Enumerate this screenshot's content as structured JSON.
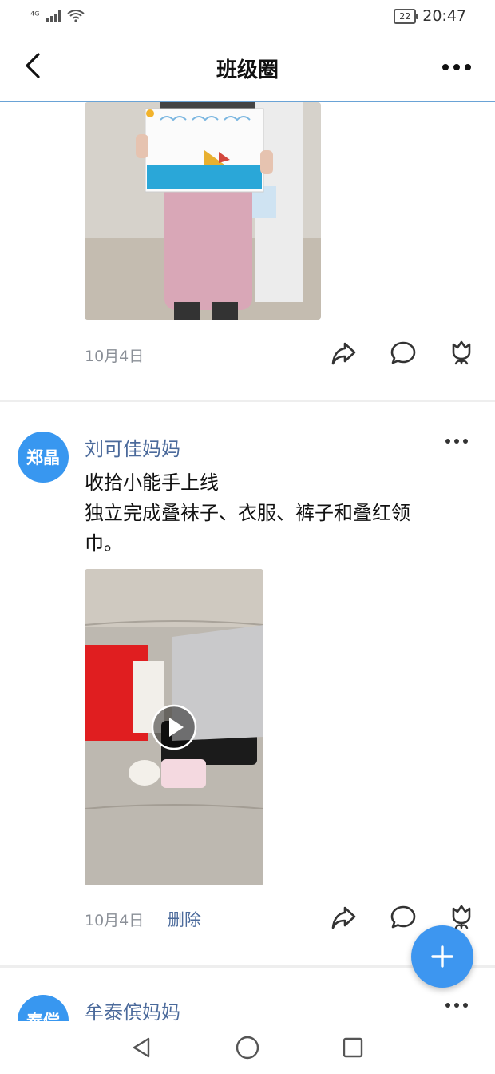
{
  "status": {
    "signal": "⁴ᴳ",
    "battery": "22",
    "time": "20:47"
  },
  "header": {
    "title": "班级圈"
  },
  "post1": {
    "date": "10月4日"
  },
  "post2": {
    "avatar": "郑晶",
    "author": "刘可佳妈妈",
    "text_line1": "收拾小能手上线",
    "text_line2": "独立完成叠袜子、衣服、裤子和叠红领",
    "text_line3": "巾。",
    "date": "10月4日",
    "delete_label": "删除"
  },
  "post3": {
    "avatar": "泰偿",
    "author": "牟泰傧妈妈"
  },
  "colors": {
    "accent": "#3897f0",
    "author": "#4b6a9b",
    "header_border": "#6aa3d6"
  }
}
